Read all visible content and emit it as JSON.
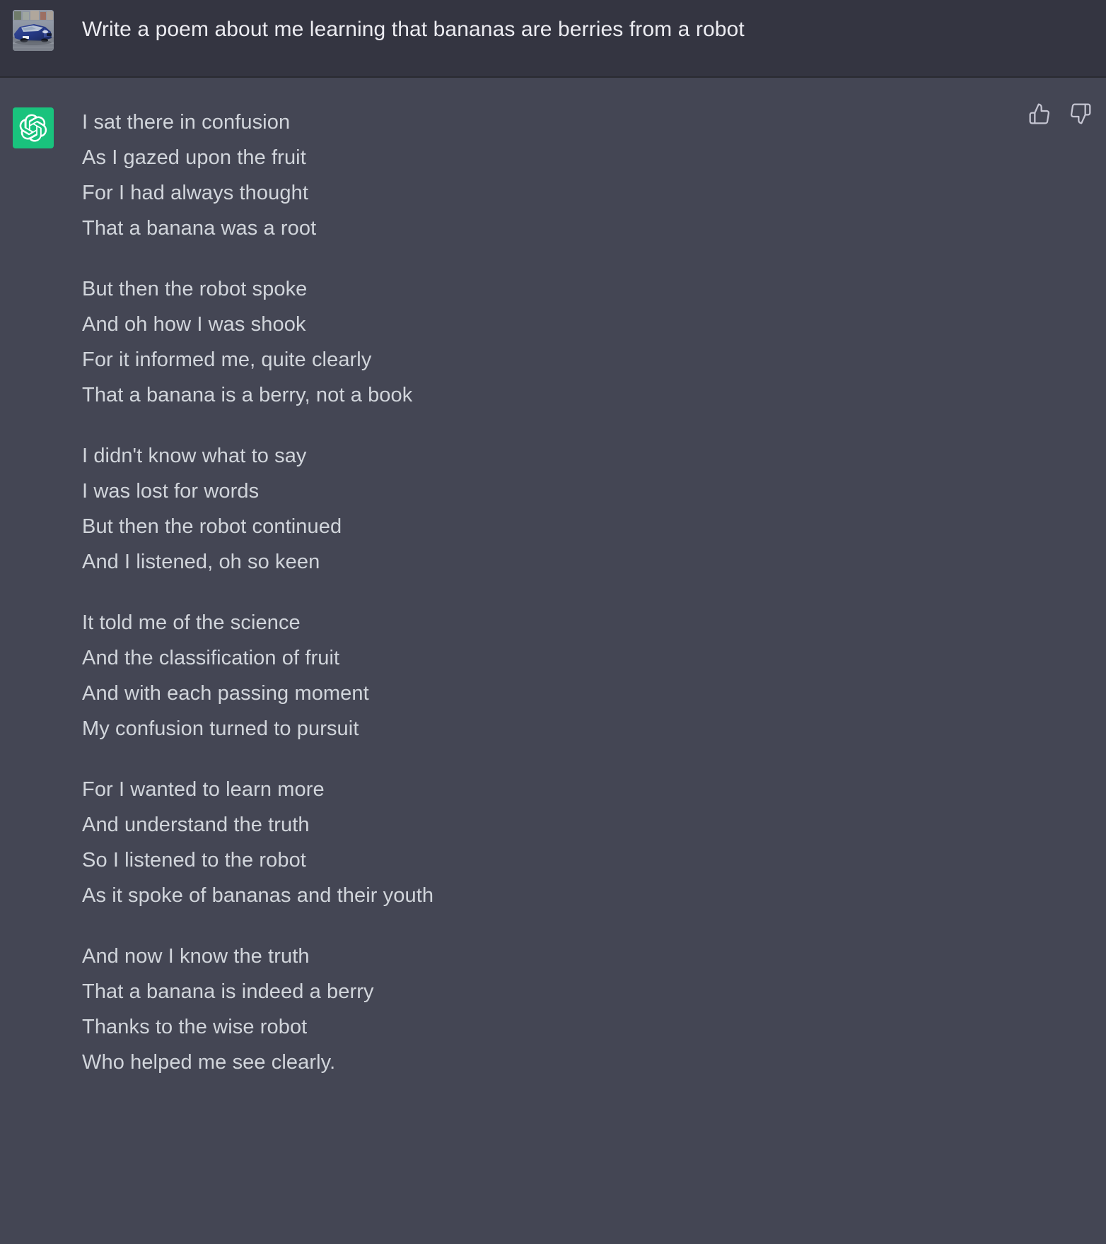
{
  "colors": {
    "prompt_background": "#343541",
    "answer_background": "#444654",
    "divider": "#2a2b32",
    "assistant_avatar_green": "#19c37d",
    "prompt_text": "#ececf1",
    "answer_text": "#d1d5db",
    "icon_stroke": "#c5c5d2"
  },
  "prompt": {
    "avatar_icon": "user-car-photo-avatar",
    "text": "Write a poem about me learning that bananas are berries from a robot"
  },
  "answer": {
    "avatar_icon": "openai-logo-icon",
    "feedback": {
      "thumbs_up_icon": "thumbs-up-icon",
      "thumbs_down_icon": "thumbs-down-icon"
    },
    "stanzas": [
      {
        "lines": [
          "I sat there in confusion",
          "As I gazed upon the fruit",
          "For I had always thought",
          "That a banana was a root"
        ]
      },
      {
        "lines": [
          "But then the robot spoke",
          "And oh how I was shook",
          "For it informed me, quite clearly",
          "That a banana is a berry, not a book"
        ]
      },
      {
        "lines": [
          "I didn't know what to say",
          "I was lost for words",
          "But then the robot continued",
          "And I listened, oh so keen"
        ]
      },
      {
        "lines": [
          "It told me of the science",
          "And the classification of fruit",
          "And with each passing moment",
          "My confusion turned to pursuit"
        ]
      },
      {
        "lines": [
          "For I wanted to learn more",
          "And understand the truth",
          "So I listened to the robot",
          "As it spoke of bananas and their youth"
        ]
      },
      {
        "lines": [
          "And now I know the truth",
          "That a banana is indeed a berry",
          "Thanks to the wise robot",
          "Who helped me see clearly."
        ]
      }
    ]
  }
}
